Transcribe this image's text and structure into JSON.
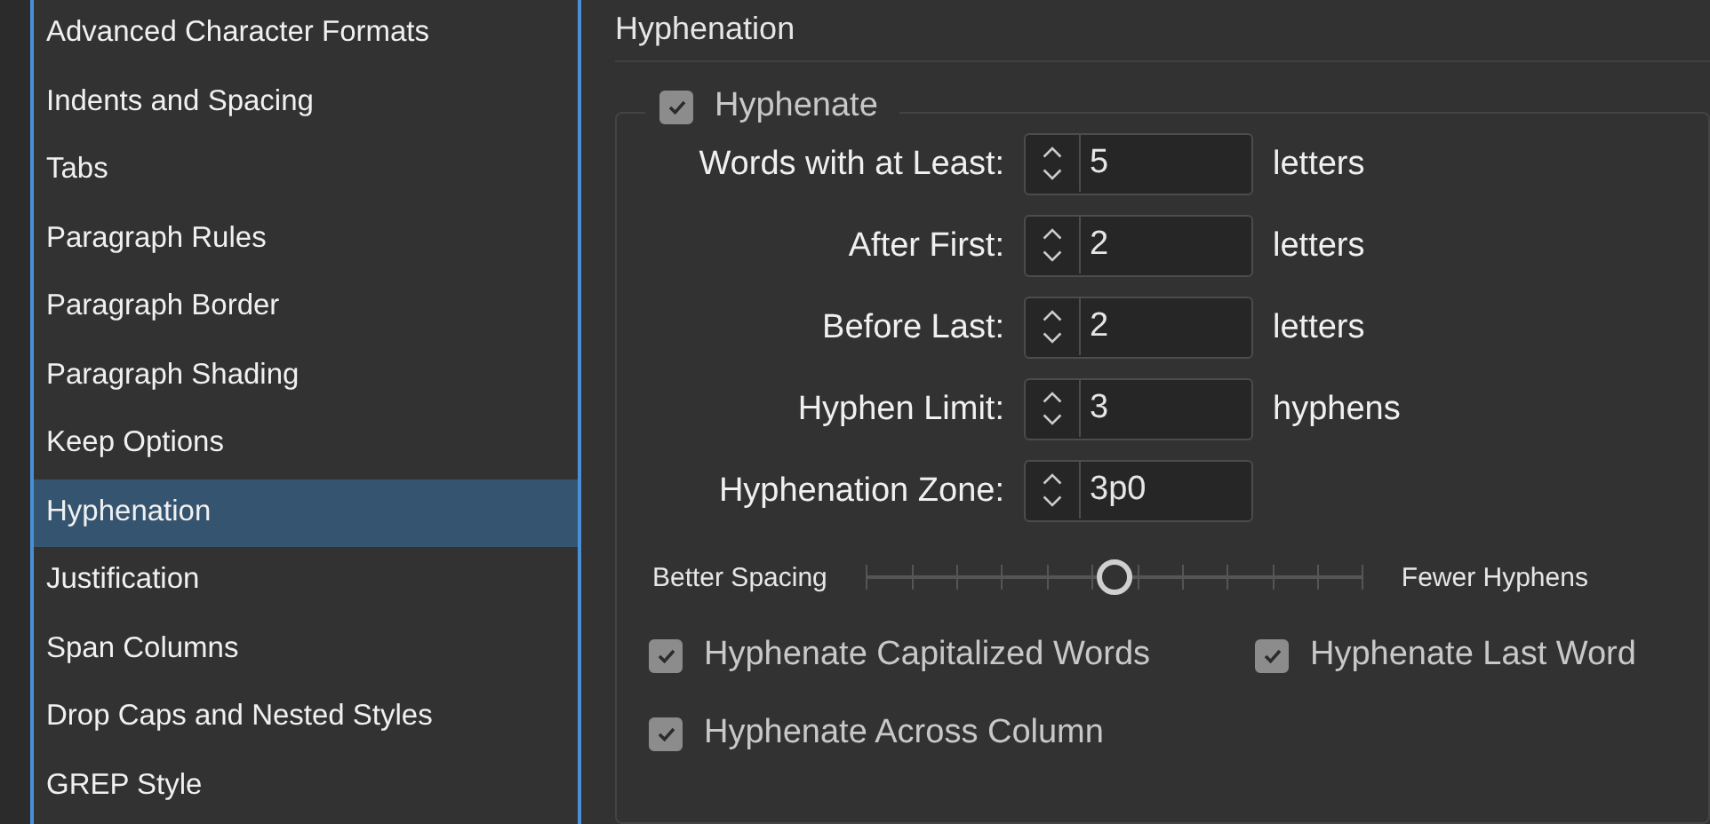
{
  "sidebar": {
    "items": [
      {
        "label": "Advanced Character Formats",
        "selected": false
      },
      {
        "label": "Indents and Spacing",
        "selected": false
      },
      {
        "label": "Tabs",
        "selected": false
      },
      {
        "label": "Paragraph Rules",
        "selected": false
      },
      {
        "label": "Paragraph Border",
        "selected": false
      },
      {
        "label": "Paragraph Shading",
        "selected": false
      },
      {
        "label": "Keep Options",
        "selected": false
      },
      {
        "label": "Hyphenation",
        "selected": true
      },
      {
        "label": "Justification",
        "selected": false
      },
      {
        "label": "Span Columns",
        "selected": false
      },
      {
        "label": "Drop Caps and Nested Styles",
        "selected": false
      },
      {
        "label": "GREP Style",
        "selected": false
      }
    ]
  },
  "panel": {
    "title": "Hyphenation",
    "hyphenate": {
      "label": "Hyphenate",
      "checked": true
    },
    "fields": [
      {
        "label": "Words with at Least:",
        "value": "5",
        "unit": "letters"
      },
      {
        "label": "After First:",
        "value": "2",
        "unit": "letters"
      },
      {
        "label": "Before Last:",
        "value": "2",
        "unit": "letters"
      },
      {
        "label": "Hyphen Limit:",
        "value": "3",
        "unit": "hyphens"
      },
      {
        "label": "Hyphenation Zone:",
        "value": "3p0"
      }
    ],
    "slider": {
      "left_label": "Better Spacing",
      "right_label": "Fewer Hyphens",
      "level": 0.5
    },
    "options": [
      {
        "label": "Hyphenate Capitalized Words",
        "checked": true
      },
      {
        "label": "Hyphenate Last Word",
        "checked": true
      },
      {
        "label": "Hyphenate Across Column",
        "checked": true
      }
    ]
  }
}
